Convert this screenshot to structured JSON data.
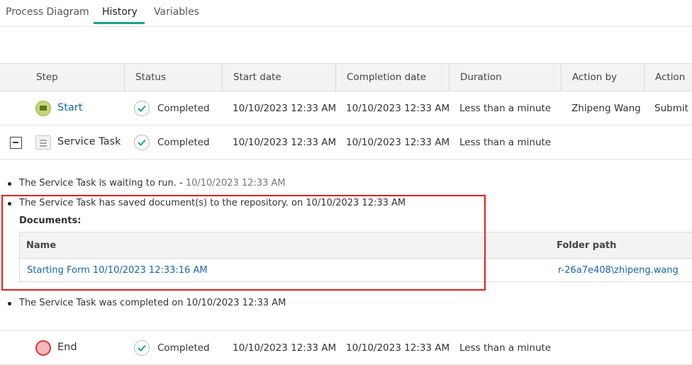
{
  "tabs": [
    {
      "label": "Process Diagram"
    },
    {
      "label": "History"
    },
    {
      "label": "Variables"
    }
  ],
  "active_tab": "History",
  "accent_color": "#17a589",
  "link_color": "#1565b0",
  "highlight_color": "#e02020",
  "columns": [
    "Step",
    "Status",
    "Start date",
    "Completion date",
    "Duration",
    "Action by",
    "Action"
  ],
  "rows": [
    {
      "step": "Start",
      "status": "Completed",
      "start": "10/10/2023 12:33 AM",
      "completion": "10/10/2023 12:33 AM",
      "duration": "Less than a minute",
      "action_by": "Zhipeng Wang",
      "action": "Submit"
    },
    {
      "step": "Service Task",
      "status": "Completed",
      "start": "10/10/2023 12:33 AM",
      "completion": "10/10/2023 12:33 AM",
      "duration": "Less than a minute",
      "action_by": "",
      "action": ""
    },
    {
      "step": "End",
      "status": "Completed",
      "start": "10/10/2023 12:33 AM",
      "completion": "10/10/2023 12:33 AM",
      "duration": "Less than a minute",
      "action_by": "",
      "action": ""
    }
  ],
  "log": {
    "waiting": {
      "text": "The Service Task is waiting to run. - ",
      "time": "10/10/2023 12:33 AM"
    },
    "saved": "The Service Task has saved document(s) to the repository. on 10/10/2023 12:33 AM",
    "documents_label": "Documents:",
    "documents": {
      "columns": [
        "Name",
        "Folder path"
      ],
      "items": [
        {
          "name": "Starting Form 10/10/2023 12:33:16 AM",
          "folder": "r-26a7e408\\zhipeng.wang"
        }
      ]
    },
    "completed": "The Service Task was completed on 10/10/2023 12:33 AM"
  }
}
